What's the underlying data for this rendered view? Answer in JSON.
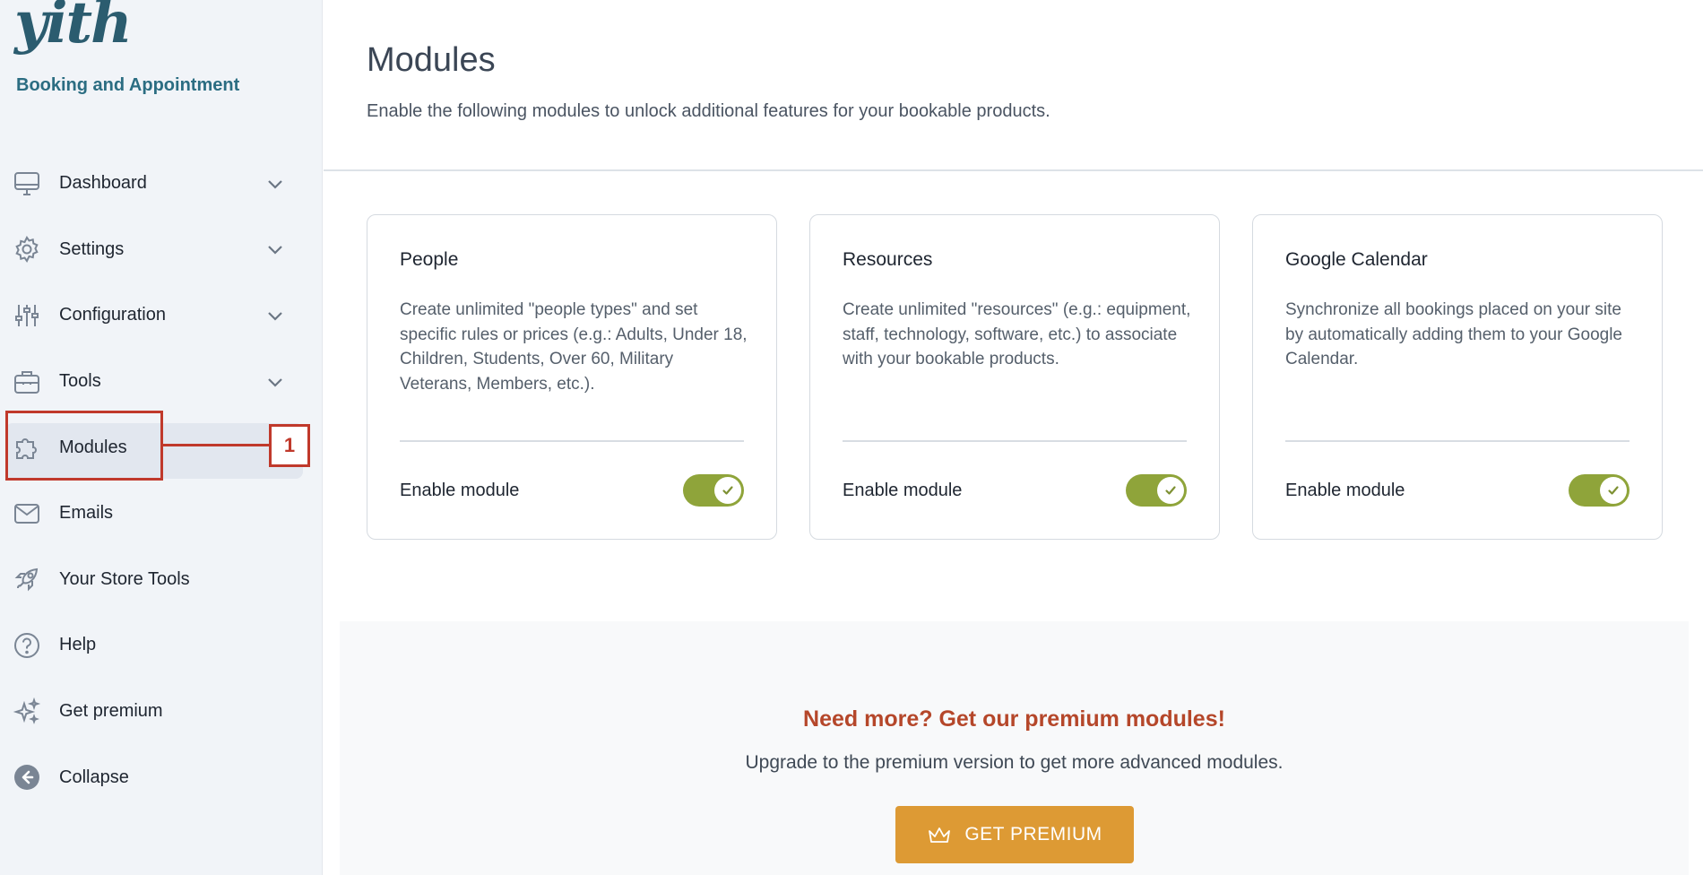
{
  "brand": {
    "logo_text": "yith",
    "subtitle": "Booking and Appointment"
  },
  "sidebar": {
    "items": [
      {
        "label": "Dashboard",
        "icon": "monitor-icon",
        "expandable": true
      },
      {
        "label": "Settings",
        "icon": "gear-icon",
        "expandable": true
      },
      {
        "label": "Configuration",
        "icon": "sliders-icon",
        "expandable": true
      },
      {
        "label": "Tools",
        "icon": "toolbox-icon",
        "expandable": true
      },
      {
        "label": "Modules",
        "icon": "puzzle-icon",
        "expandable": false,
        "active": true
      },
      {
        "label": "Emails",
        "icon": "envelope-icon",
        "expandable": false
      },
      {
        "label": "Your Store Tools",
        "icon": "rocket-icon",
        "expandable": false
      },
      {
        "label": "Help",
        "icon": "question-circle-icon",
        "expandable": false
      },
      {
        "label": "Get premium",
        "icon": "sparkles-icon",
        "expandable": false
      },
      {
        "label": "Collapse",
        "icon": "arrow-left-circle-icon",
        "expandable": false
      }
    ]
  },
  "annotation": {
    "badge": "1",
    "color": "#c0392b"
  },
  "main": {
    "title": "Modules",
    "description": "Enable the following modules to unlock additional features for your bookable products."
  },
  "modules": [
    {
      "title": "People",
      "description": "Create unlimited \"people types\" and set specific rules or prices (e.g.: Adults, Under 18, Children, Students, Over 60, Military Veterans, Members, etc.).",
      "enable_label": "Enable module",
      "enabled": true
    },
    {
      "title": "Resources",
      "description": "Create unlimited \"resources\" (e.g.: equipment, staff, technology, software, etc.) to associate with your bookable products.",
      "enable_label": "Enable module",
      "enabled": true
    },
    {
      "title": "Google Calendar",
      "description": "Synchronize all bookings placed on your site by automatically adding them to your Google Calendar.",
      "enable_label": "Enable module",
      "enabled": true
    }
  ],
  "promo": {
    "title": "Need more? Get our premium modules!",
    "description": "Upgrade to the premium version to get more advanced modules.",
    "button_label": "GET PREMIUM",
    "button_icon": "crown-icon"
  },
  "colors": {
    "toggle_on": "#8fa43a",
    "promo_button": "#dd9a34",
    "promo_title": "#b5472a",
    "brand": "#2b6d82"
  }
}
